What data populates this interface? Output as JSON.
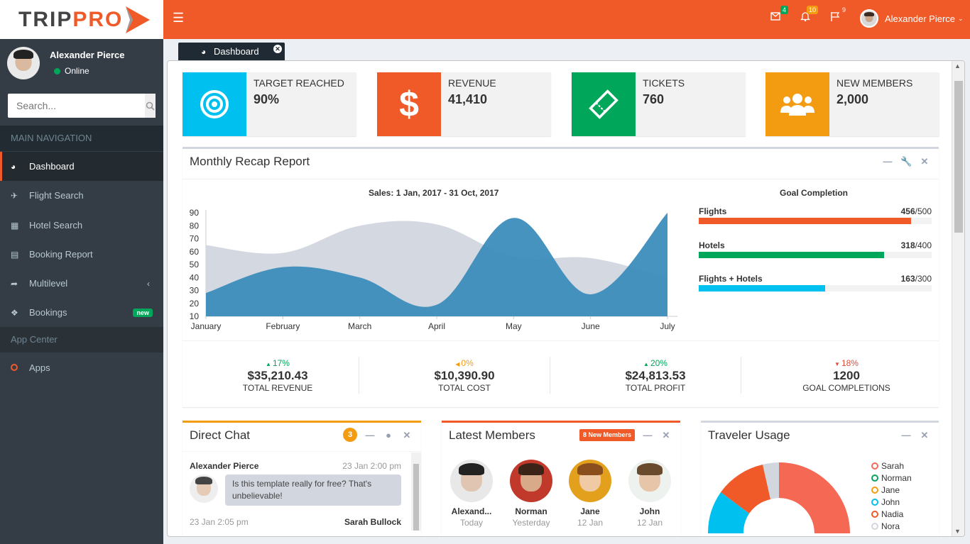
{
  "app": {
    "logo_part1": "TRIP",
    "logo_part2": "PRO"
  },
  "header": {
    "mail_count": "4",
    "bell_count": "10",
    "flag_count": "9",
    "user_name": "Alexander Pierce"
  },
  "sidebar": {
    "user_name": "Alexander Pierce",
    "status": "Online",
    "search_placeholder": "Search...",
    "main_nav_header": "MAIN NAVIGATION",
    "items": [
      {
        "label": "Dashboard",
        "icon": "dashboard-icon"
      },
      {
        "label": "Flight Search",
        "icon": "plane-icon"
      },
      {
        "label": "Hotel Search",
        "icon": "building-icon"
      },
      {
        "label": "Booking Report",
        "icon": "report-icon"
      },
      {
        "label": "Multilevel",
        "icon": "share-icon"
      },
      {
        "label": "Bookings",
        "icon": "tag-icon",
        "badge": "new"
      }
    ],
    "app_center_header": "App Center",
    "apps_label": "Apps"
  },
  "tab": {
    "label": "Dashboard"
  },
  "infoboxes": [
    {
      "label": "TARGET REACHED",
      "value": "90%",
      "color": "#00c0ef"
    },
    {
      "label": "REVENUE",
      "value": "41,410",
      "color": "#f05a28"
    },
    {
      "label": "TICKETS",
      "value": "760",
      "color": "#00a65a"
    },
    {
      "label": "NEW MEMBERS",
      "value": "2,000",
      "color": "#f39c12"
    }
  ],
  "recap": {
    "title": "Monthly Recap Report",
    "chart_title": "Sales: 1 Jan, 2017 - 31 Oct, 2017",
    "goal_title": "Goal Completion",
    "goals": [
      {
        "label": "Flights",
        "value": "456",
        "total": "/500",
        "fraction": 0.912,
        "color": "#f05a28"
      },
      {
        "label": "Hotels",
        "value": "318",
        "total": "/400",
        "fraction": 0.795,
        "color": "#00a65a"
      },
      {
        "label": "Flights + Hotels",
        "value": "163",
        "total": "/300",
        "fraction": 0.543,
        "color": "#00c0ef"
      }
    ],
    "stats": [
      {
        "pct": "17%",
        "dir": "up",
        "color": "#00a65a",
        "value": "$35,210.43",
        "label": "TOTAL REVENUE"
      },
      {
        "pct": "0%",
        "dir": "left",
        "color": "#f39c12",
        "value": "$10,390.90",
        "label": "TOTAL COST"
      },
      {
        "pct": "20%",
        "dir": "up",
        "color": "#00a65a",
        "value": "$24,813.53",
        "label": "TOTAL PROFIT"
      },
      {
        "pct": "18%",
        "dir": "down",
        "color": "#dd4b39",
        "value": "1200",
        "label": "GOAL COMPLETIONS"
      }
    ]
  },
  "chart_data": {
    "type": "area",
    "title": "Sales: 1 Jan, 2017 - 31 Oct, 2017",
    "categories": [
      "January",
      "February",
      "March",
      "April",
      "May",
      "June",
      "July"
    ],
    "yticks": [
      10,
      20,
      30,
      40,
      50,
      60,
      70,
      80,
      90
    ],
    "ylim": [
      10,
      90
    ],
    "series": [
      {
        "values": [
          65,
          59,
          80,
          81,
          56,
          55,
          40
        ],
        "color": "#d2d6de"
      },
      {
        "values": [
          28,
          48,
          40,
          19,
          86,
          27,
          90
        ],
        "color": "#3c8dbc"
      }
    ]
  },
  "chat": {
    "title": "Direct Chat",
    "badge": "3",
    "messages": [
      {
        "name": "Alexander Pierce",
        "time": "23 Jan 2:00 pm",
        "text": "Is this template really for free? That's unbelievable!"
      },
      {
        "name": "Sarah Bullock",
        "time": "23 Jan 2:05 pm"
      }
    ]
  },
  "members": {
    "title": "Latest Members",
    "badge": "8 New Members",
    "list": [
      {
        "name": "Alexand...",
        "date": "Today"
      },
      {
        "name": "Norman",
        "date": "Yesterday"
      },
      {
        "name": "Jane",
        "date": "12 Jan"
      },
      {
        "name": "John",
        "date": "12 Jan"
      }
    ]
  },
  "usage": {
    "title": "Traveler Usage",
    "legend": [
      {
        "label": "Sarah",
        "color": "#f56954"
      },
      {
        "label": "Norman",
        "color": "#00a65a"
      },
      {
        "label": "Jane",
        "color": "#f39c12"
      },
      {
        "label": "John",
        "color": "#00c0ef"
      },
      {
        "label": "Nadia",
        "color": "#f05a28"
      },
      {
        "label": "Nora",
        "color": "#d2d6de"
      }
    ]
  }
}
